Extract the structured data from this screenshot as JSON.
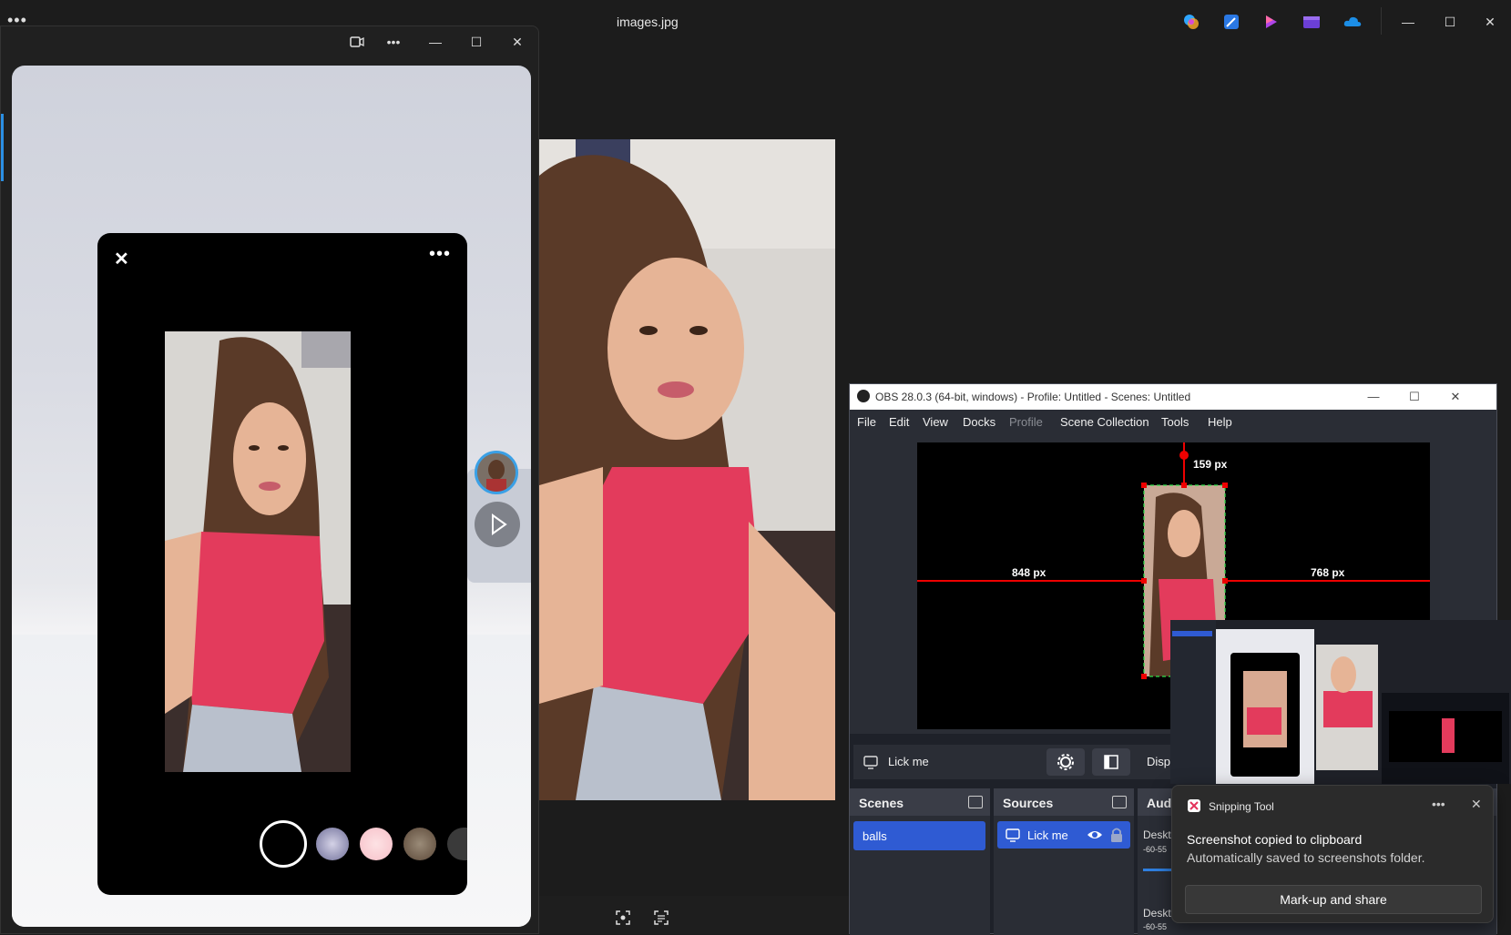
{
  "photos": {
    "title": "images.jpg",
    "more_label": "•••",
    "window_controls": {
      "minimize": "—",
      "maximize": "☐",
      "close": "✕"
    },
    "taskbar_icons": [
      "copilot-icon",
      "designer-icon",
      "clipchamp-icon",
      "video-editor-icon",
      "onedrive-icon"
    ]
  },
  "camera": {
    "window_controls": {
      "video": "▭",
      "more": "•••",
      "minimize": "—",
      "maximize": "☐",
      "close": "✕"
    },
    "phone": {
      "close": "✕",
      "more": "•••"
    }
  },
  "obs": {
    "title": "OBS 28.0.3 (64-bit, windows) - Profile: Untitled - Scenes: Untitled",
    "menu": [
      "File",
      "Edit",
      "View",
      "Docks",
      "Profile",
      "Scene Collection",
      "Tools",
      "Help"
    ],
    "preview": {
      "top_px": "159 px",
      "left_px": "848 px",
      "right_px": "768 px"
    },
    "source_bar": {
      "name": "Lick me",
      "display": "Display"
    },
    "scenes": {
      "title": "Scenes",
      "items": [
        "balls"
      ]
    },
    "sources": {
      "title": "Sources",
      "items": [
        "Lick me"
      ]
    },
    "audio": {
      "title": "Audio Mixer",
      "items": [
        "Desktop Audio",
        "Desktop Audio"
      ],
      "db": "-60-55"
    }
  },
  "toast": {
    "app": "Snipping Tool",
    "more": "•••",
    "close": "✕",
    "heading": "Screenshot copied to clipboard",
    "body": "Automatically saved to screenshots folder.",
    "button": "Mark-up and share"
  }
}
